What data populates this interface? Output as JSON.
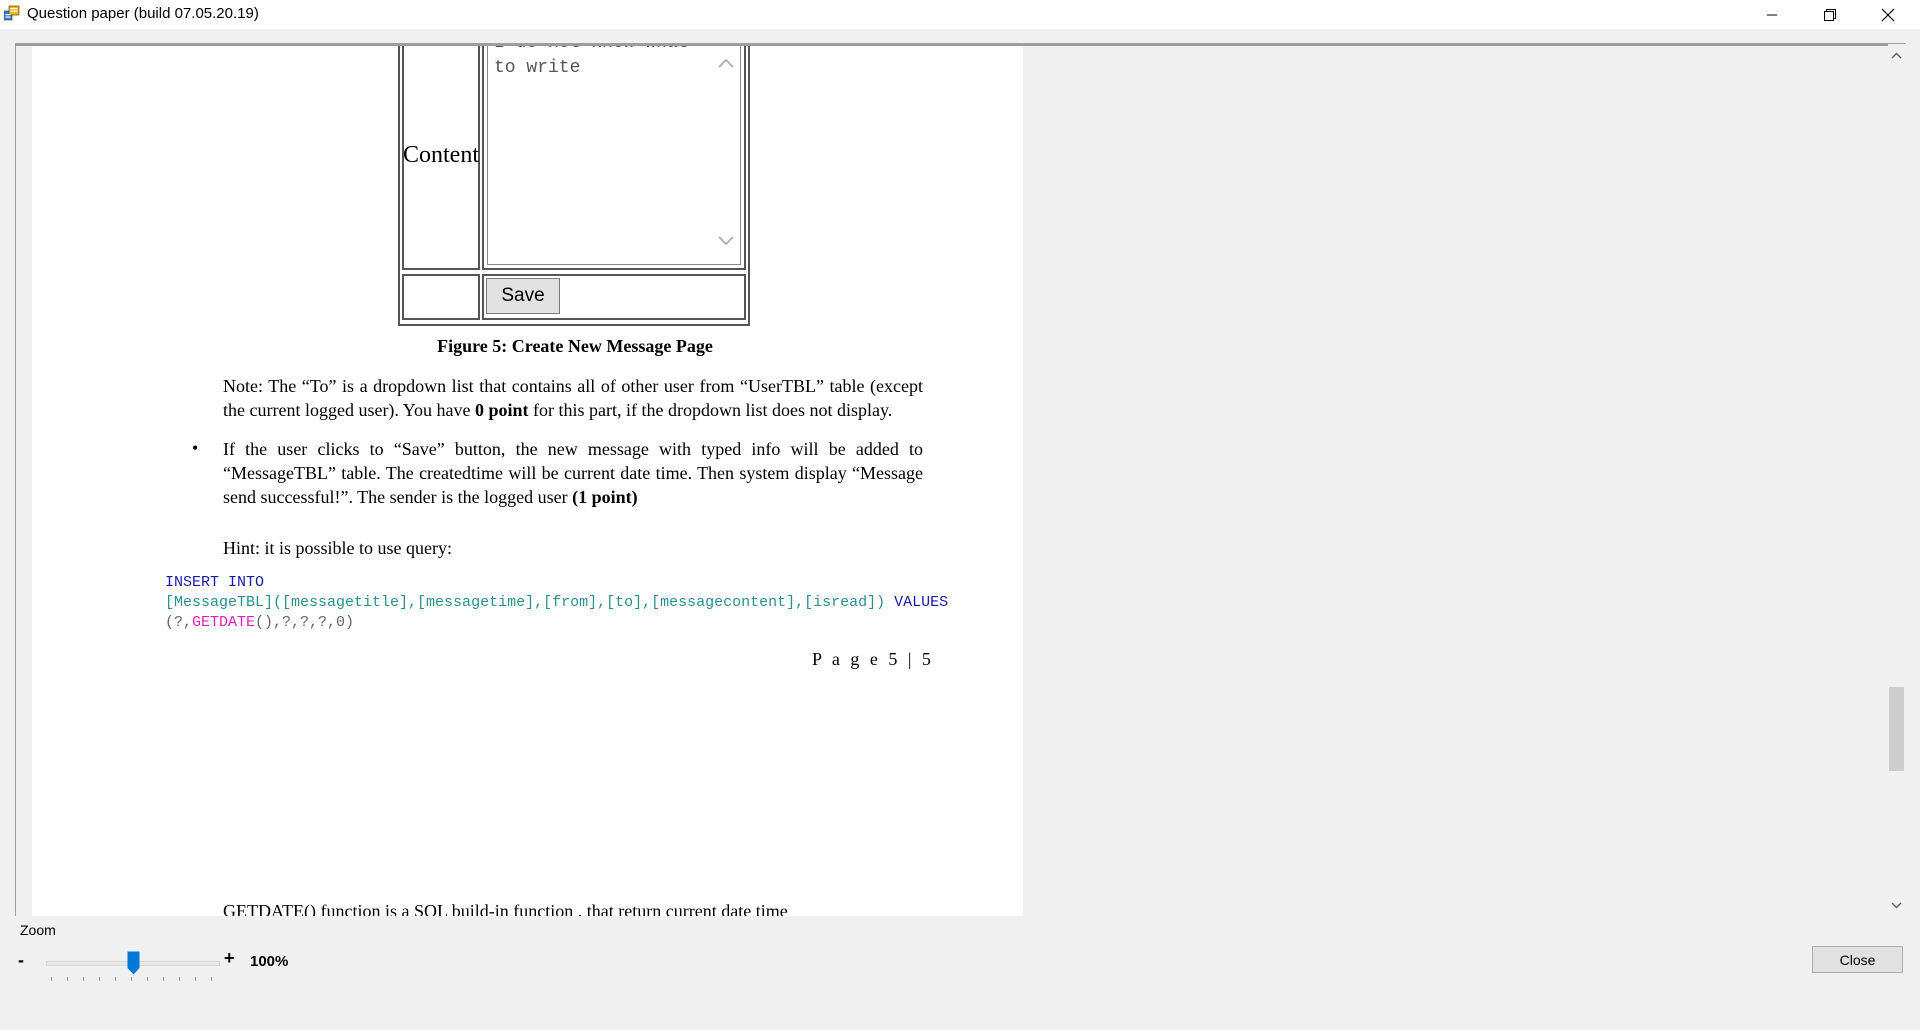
{
  "window": {
    "title": "Question paper (build 07.05.20.19)"
  },
  "form": {
    "content_label": "Content",
    "textarea_line1": "I do not know what",
    "textarea_line2": "to write",
    "save_label": "Save"
  },
  "document": {
    "caption": "Figure 5: Create New Message Page",
    "note_text": "Note: The “To” is a dropdown list that contains all of other user from “UserTBL” table (except the current logged user). You have ",
    "note_bold": "0 point",
    "note_tail": " for this part, if the dropdown list does not display.",
    "bullet_text": "If the user clicks to “Save” button, the new message with typed info will be added to “MessageTBL” table. The createdtime will be current date time. Then system display “Message send successful!”. The sender is the logged user ",
    "bullet_bold": "(1 point)",
    "hint": "Hint: it is possible to use query:",
    "code_kw1": "INSERT INTO",
    "code_table": "[MessageTBL]",
    "code_cols": "([messagetitle],[messagetime],[from],[to],[messagecontent],[isread])",
    "code_values_kw": "VALUES",
    "code_open": "(?,",
    "code_fn": "GETDATE",
    "code_rest": "(),?,?,?,0)",
    "page_number": "P a g e  5 | 5",
    "cut_text": "GETDATE() function is a SQL build-in function , that return current date time"
  },
  "zoom": {
    "label": "Zoom",
    "minus": "-",
    "plus": "+",
    "value": "100%",
    "level_fraction": 0.5
  },
  "footer": {
    "close_label": "Close"
  },
  "colors": {
    "accent": "#0078d7",
    "sql_keyword": "#1a1aa6",
    "sql_identifier": "#2a9090",
    "sql_function": "#e020c0"
  },
  "icons": [
    "app-icon",
    "minimize-icon",
    "restore-icon",
    "close-icon",
    "scroll-up-icon",
    "scroll-down-icon"
  ]
}
